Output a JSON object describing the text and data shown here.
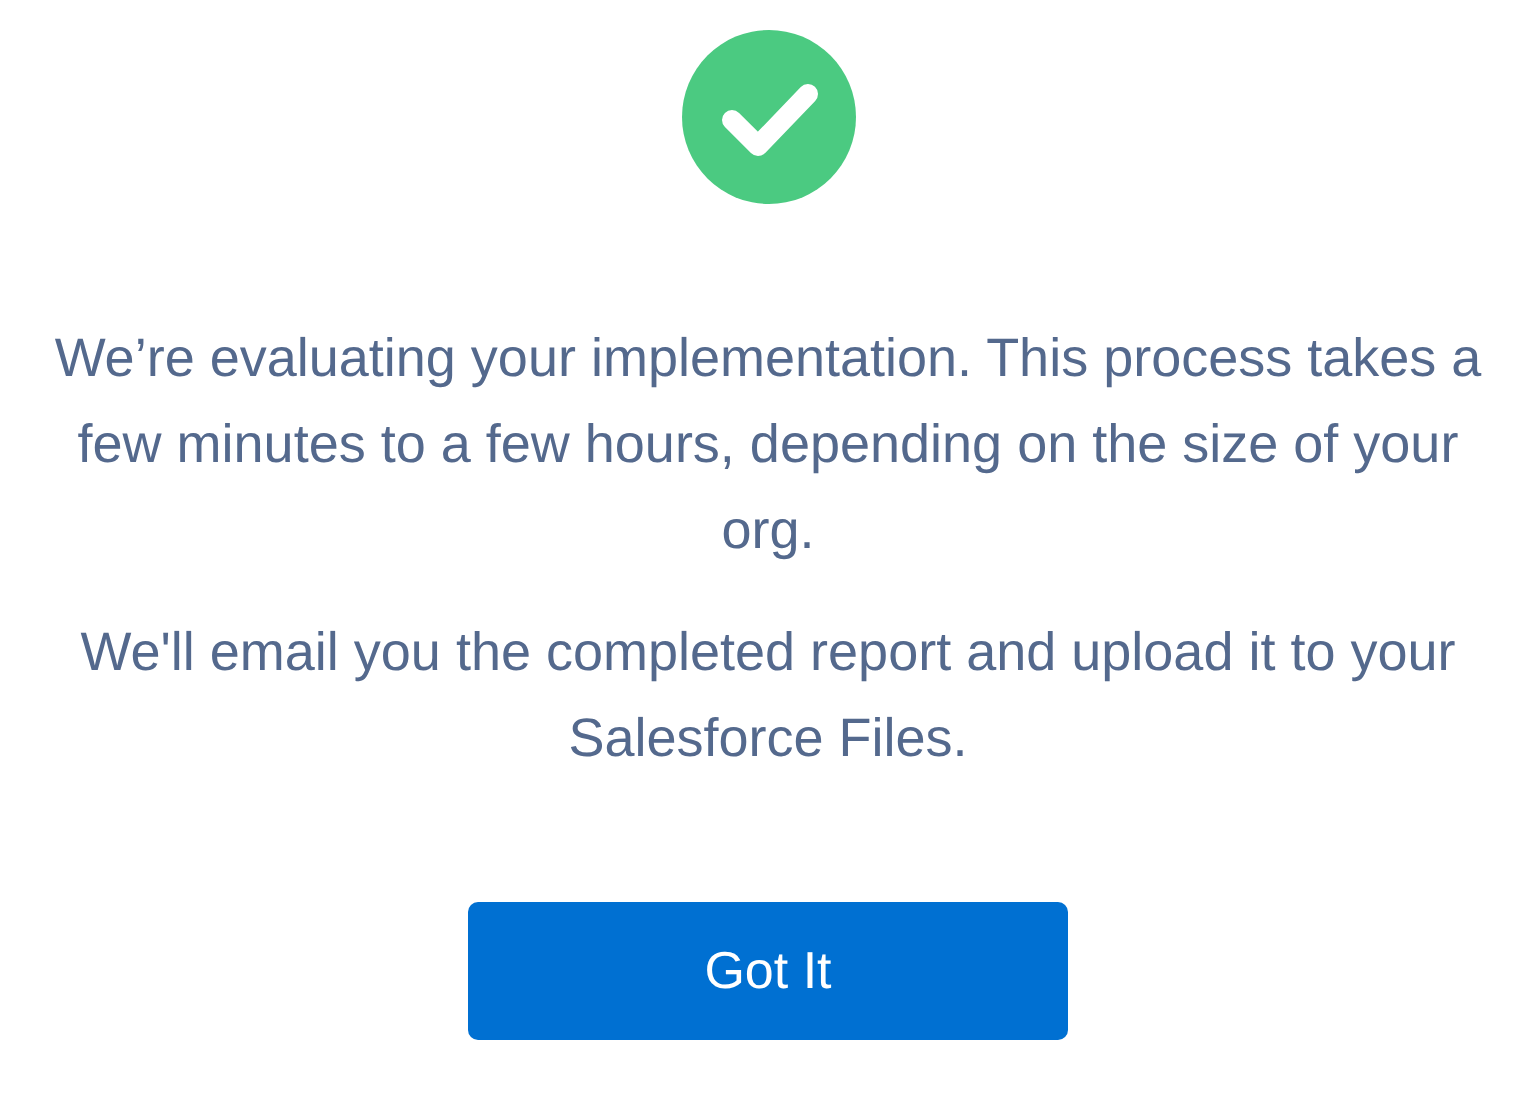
{
  "status_icon": {
    "kind": "success"
  },
  "paragraphs": [
    "We’re evaluating your implementation. This process takes a few minutes to a few hours, depending on the size of your org.",
    "We'll email you the completed report and upload it to your Salesforce Files."
  ],
  "button": {
    "label": "Got It"
  }
}
